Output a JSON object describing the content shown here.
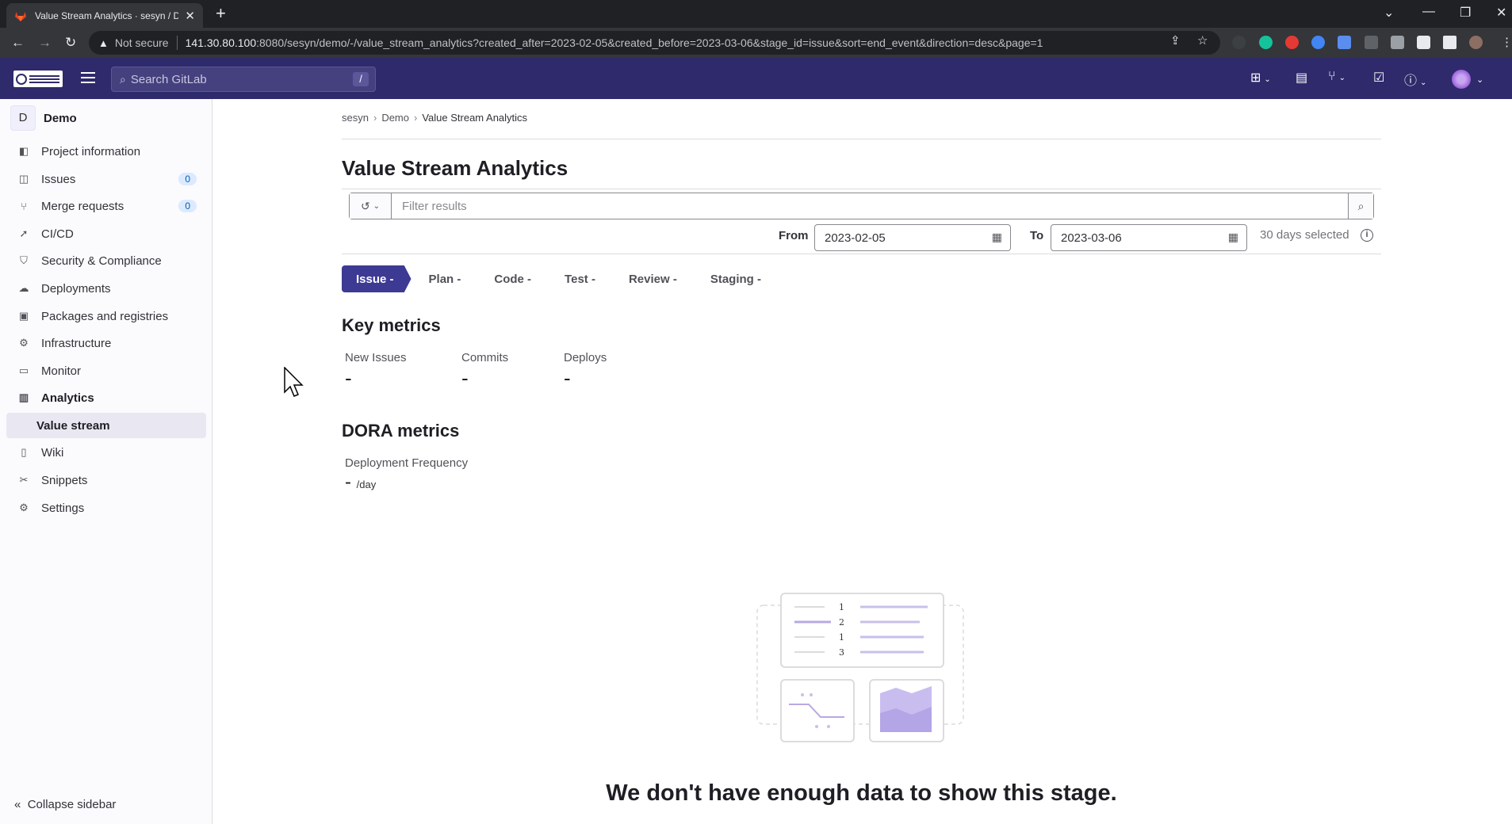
{
  "browser": {
    "tab_title": "Value Stream Analytics · sesyn / Dem",
    "not_secure": "Not secure",
    "url_host": "141.30.80.100",
    "url_rest": ":8080/sesyn/demo/-/value_stream_analytics?created_after=2023-02-05&created_before=2023-03-06&stage_id=issue&sort=end_event&direction=desc&page=1"
  },
  "topbar": {
    "search_placeholder": "Search GitLab",
    "search_shortcut": "/"
  },
  "sidebar": {
    "project_initial": "D",
    "project_name": "Demo",
    "items": [
      {
        "label": "Project information"
      },
      {
        "label": "Issues",
        "badge": "0"
      },
      {
        "label": "Merge requests",
        "badge": "0"
      },
      {
        "label": "CI/CD"
      },
      {
        "label": "Security & Compliance"
      },
      {
        "label": "Deployments"
      },
      {
        "label": "Packages and registries"
      },
      {
        "label": "Infrastructure"
      },
      {
        "label": "Monitor"
      },
      {
        "label": "Analytics"
      },
      {
        "label": "Value stream"
      },
      {
        "label": "Wiki"
      },
      {
        "label": "Snippets"
      },
      {
        "label": "Settings"
      }
    ],
    "collapse_label": "Collapse sidebar"
  },
  "breadcrumb": [
    "sesyn",
    "Demo",
    "Value Stream Analytics"
  ],
  "page": {
    "title": "Value Stream Analytics",
    "filter_placeholder": "Filter results",
    "from_label": "From",
    "from_date": "2023-02-05",
    "to_label": "To",
    "to_date": "2023-03-06",
    "days_selected": "30 days selected"
  },
  "stages": [
    "Issue -",
    "Plan -",
    "Code -",
    "Test -",
    "Review -",
    "Staging -"
  ],
  "key_metrics": {
    "title": "Key metrics",
    "items": [
      {
        "label": "New Issues",
        "value": "-"
      },
      {
        "label": "Commits",
        "value": "-"
      },
      {
        "label": "Deploys",
        "value": "-"
      }
    ]
  },
  "dora_metrics": {
    "title": "DORA metrics",
    "label": "Deployment Frequency",
    "value": "-",
    "unit": "/day"
  },
  "empty_state": {
    "title": "We don't have enough data to show this stage.",
    "rank_numbers": [
      "1",
      "2",
      "1",
      "3"
    ]
  },
  "colors": {
    "topbar": "#2f2a6b",
    "stage_active": "#3d3a93",
    "illustration_accent": "#b9a8e3"
  }
}
